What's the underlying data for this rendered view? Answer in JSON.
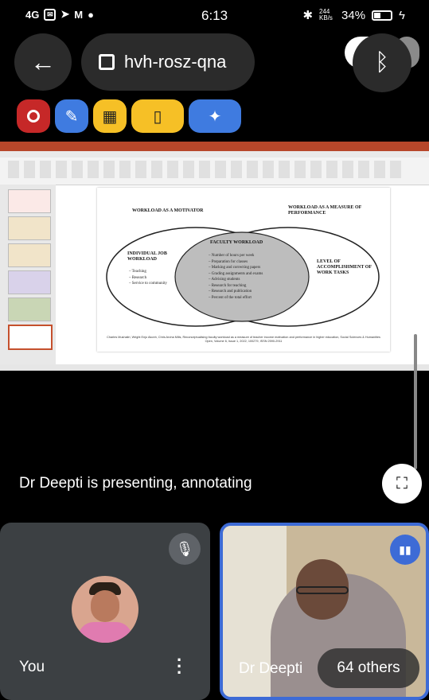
{
  "status_bar": {
    "left_text": "4G",
    "time": "6:13",
    "net_speed": "244 KB/s",
    "battery": "34%"
  },
  "top": {
    "meeting_code": "hvh-rosz-qna"
  },
  "slide": {
    "venn": {
      "left_title": "WORKLOAD AS A MOTIVATOR",
      "right_title": "WORKLOAD AS A MEASURE OF PERFORMANCE",
      "left_heading": "INDIVIDUAL JOB WORKLOAD",
      "left_items": [
        "Teaching",
        "Research",
        "Service to community"
      ],
      "center_heading": "FACULTY WORKLOAD",
      "center_items": [
        "Number of hours per week",
        "Preparation for classes",
        "Marking and correcting papers",
        "Grading assignments and exams",
        "Advising students",
        "Research for teaching",
        "Research and publication",
        "Percent of the total effort"
      ],
      "right_heading": "LEVEL OF ACCOMPLISHMENT OF WORK TASKS"
    },
    "citation": "Charles Mushaliri, Wright Enjo Akonh, Chris Aroha Mills, Reconceptualising faculty workload as a measure of teacher income motivation and performance in higher education, Social Sciences & Humanities Open, Volume 6, Issue 1, 2022, 100279, ISSN 2590-2911"
  },
  "presenting": {
    "label": "Dr Deepti is presenting, annotating"
  },
  "tiles": {
    "you_label": "You",
    "dd_label": "Dr Deepti",
    "others_label": "64 others"
  }
}
